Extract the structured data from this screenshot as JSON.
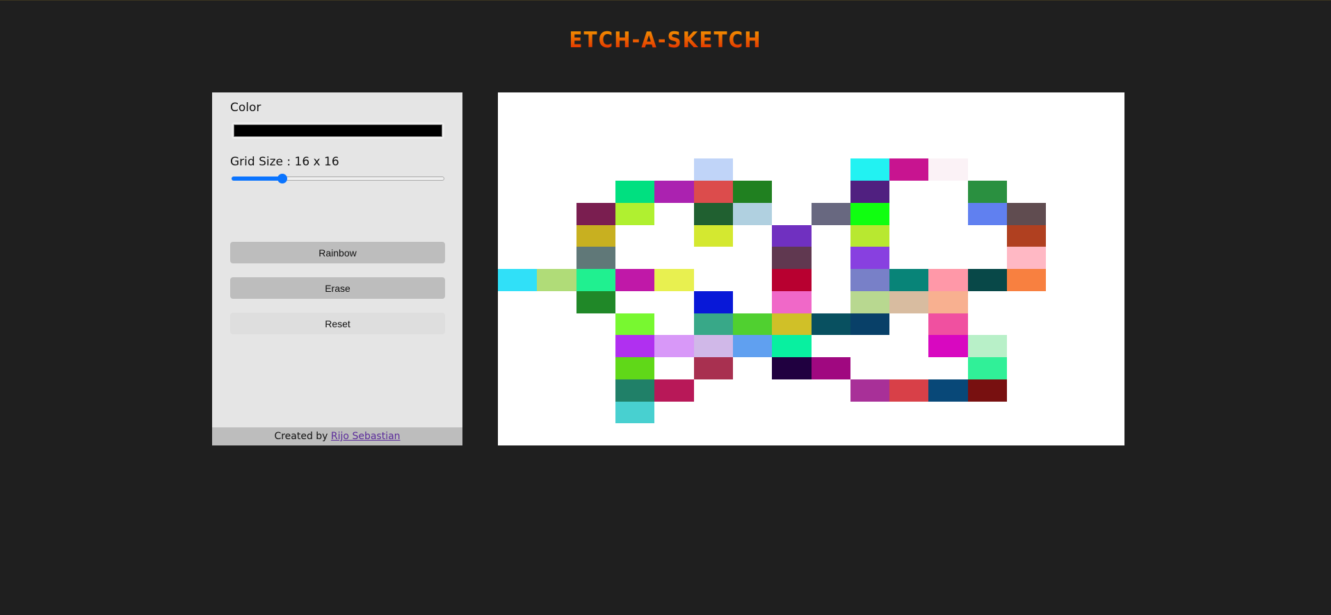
{
  "header": {
    "title": "ETCH-A-SKETCH"
  },
  "sidebar": {
    "color_label": "Color",
    "color_value": "#000000",
    "grid_size_label": "Grid Size : 16 x 16",
    "grid_size_value": 16,
    "slider_min": 1,
    "slider_max": 64,
    "buttons": {
      "rainbow": "Rainbow",
      "erase": "Erase",
      "reset": "Reset"
    },
    "footer": {
      "prefix": "Created by ",
      "author": "Rijo Sebastian"
    }
  },
  "grid": {
    "size": 16,
    "cells": [
      [
        3,
        5,
        "#c0d4f8"
      ],
      [
        3,
        9,
        "#22f2f2"
      ],
      [
        3,
        10,
        "#c81490"
      ],
      [
        3,
        11,
        "#fbf2f6"
      ],
      [
        4,
        3,
        "#00e080"
      ],
      [
        4,
        4,
        "#ab22b0"
      ],
      [
        4,
        5,
        "#dc4c4c"
      ],
      [
        4,
        6,
        "#208020"
      ],
      [
        4,
        9,
        "#502080"
      ],
      [
        4,
        12,
        "#2a9040"
      ],
      [
        5,
        2,
        "#7a1e50"
      ],
      [
        5,
        3,
        "#b0f030"
      ],
      [
        5,
        5,
        "#206030"
      ],
      [
        5,
        6,
        "#b0d0e0"
      ],
      [
        5,
        8,
        "#686880"
      ],
      [
        5,
        9,
        "#10ff10"
      ],
      [
        5,
        12,
        "#6080f0"
      ],
      [
        5,
        13,
        "#604c50"
      ],
      [
        6,
        2,
        "#c8b020"
      ],
      [
        6,
        5,
        "#d4e830"
      ],
      [
        6,
        7,
        "#7030c0"
      ],
      [
        6,
        9,
        "#b8e830"
      ],
      [
        6,
        13,
        "#b04020"
      ],
      [
        7,
        2,
        "#607878"
      ],
      [
        7,
        7,
        "#603850"
      ],
      [
        7,
        9,
        "#8840e0"
      ],
      [
        7,
        13,
        "#ffb8c4"
      ],
      [
        8,
        0,
        "#30e0f8"
      ],
      [
        8,
        1,
        "#b0dc78"
      ],
      [
        8,
        2,
        "#20f090"
      ],
      [
        8,
        3,
        "#c018a8"
      ],
      [
        8,
        4,
        "#e8f050"
      ],
      [
        8,
        7,
        "#b80030"
      ],
      [
        8,
        9,
        "#7880c8"
      ],
      [
        8,
        10,
        "#088478"
      ],
      [
        8,
        11,
        "#ff98a8"
      ],
      [
        8,
        12,
        "#084848"
      ],
      [
        8,
        13,
        "#f88040"
      ],
      [
        9,
        2,
        "#208828"
      ],
      [
        9,
        5,
        "#0818d8"
      ],
      [
        9,
        7,
        "#f068c8"
      ],
      [
        9,
        9,
        "#b8d890"
      ],
      [
        9,
        10,
        "#d8bca0"
      ],
      [
        9,
        11,
        "#f8b090"
      ],
      [
        10,
        3,
        "#78f830"
      ],
      [
        10,
        5,
        "#38a888"
      ],
      [
        10,
        6,
        "#50d030"
      ],
      [
        10,
        7,
        "#d0c028"
      ],
      [
        10,
        8,
        "#085060"
      ],
      [
        10,
        9,
        "#084068"
      ],
      [
        10,
        11,
        "#f050a0"
      ],
      [
        11,
        3,
        "#b030f0"
      ],
      [
        11,
        4,
        "#d898f8"
      ],
      [
        11,
        5,
        "#d0b8e8"
      ],
      [
        11,
        6,
        "#60a0f0"
      ],
      [
        11,
        7,
        "#08f0a0"
      ],
      [
        11,
        11,
        "#d808c0"
      ],
      [
        11,
        12,
        "#b8f0c8"
      ],
      [
        12,
        3,
        "#60d818"
      ],
      [
        12,
        5,
        "#a83050"
      ],
      [
        12,
        7,
        "#200040"
      ],
      [
        12,
        8,
        "#a00880"
      ],
      [
        12,
        12,
        "#30f098"
      ],
      [
        13,
        3,
        "#208068"
      ],
      [
        13,
        4,
        "#b81858"
      ],
      [
        13,
        9,
        "#a83098"
      ],
      [
        13,
        10,
        "#d84048"
      ],
      [
        13,
        11,
        "#084878"
      ],
      [
        13,
        12,
        "#781010"
      ],
      [
        14,
        3,
        "#48d0d0"
      ]
    ]
  }
}
